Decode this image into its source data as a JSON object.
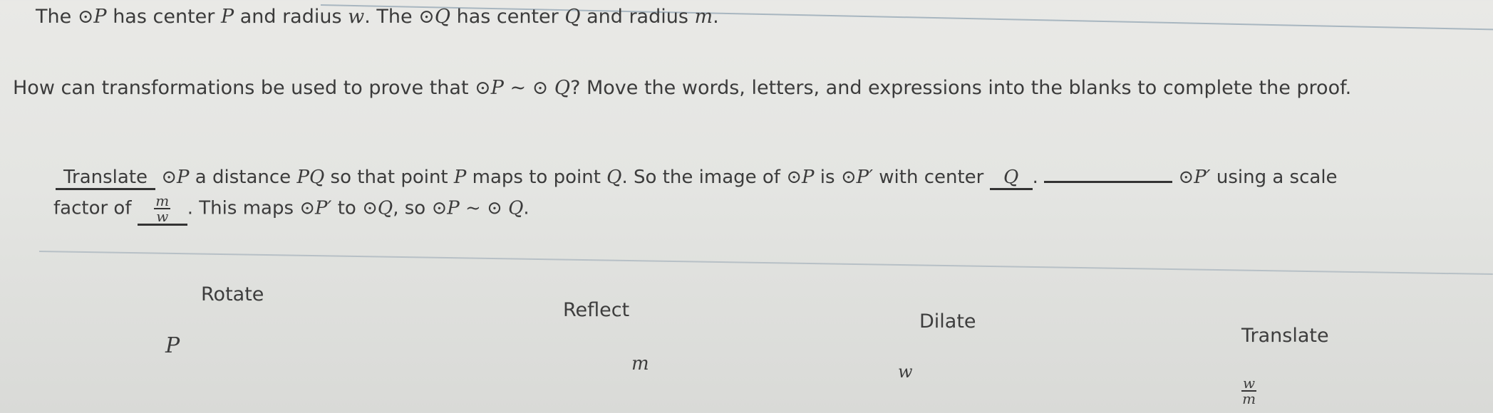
{
  "problem": {
    "line1": {
      "p1": "The ",
      "circle_p": "⊙P",
      "p2": " has center ",
      "P": "P",
      "p3": " and radius ",
      "w": "w",
      "p4": ". The ",
      "circle_q": "⊙Q",
      "p5": " has center ",
      "Q": "Q",
      "p6": " and radius ",
      "m": "m",
      "p7": "."
    },
    "line2": {
      "p1": "How can transformations be used to prove that ",
      "expr": "⊙P ~ ⊙ Q",
      "p2": "? Move the words, letters, and expressions into the blanks to complete the proof."
    }
  },
  "proof": {
    "blank1": "Translate",
    "s1": "⊙P",
    "s2": " a distance ",
    "s3": "PQ",
    "s4": " so that point ",
    "s5": "P",
    "s6": " maps to point ",
    "s7": "Q",
    "s8": ". So the image of ",
    "s9": "⊙P",
    "s10": " is ",
    "s11": "⊙P′",
    "s12": " with center ",
    "blank2": "Q",
    "s13": ". ",
    "blank3": "",
    "s14": "⊙P′",
    "s15": " using a scale",
    "s16": "factor of ",
    "blank4_num": "m",
    "blank4_den": "w",
    "s17": ". This maps ",
    "s18": "⊙P′",
    "s19": " to ",
    "s20": "⊙Q",
    "s21": ", so ",
    "s22": "⊙P ~ ⊙ Q",
    "s23": "."
  },
  "tiles": {
    "rotate": "Rotate",
    "reflect": "Reflect",
    "dilate": "Dilate",
    "translate": "Translate",
    "P": "P",
    "m": "m",
    "w": "w",
    "frac_num": "w",
    "frac_den": "m"
  }
}
